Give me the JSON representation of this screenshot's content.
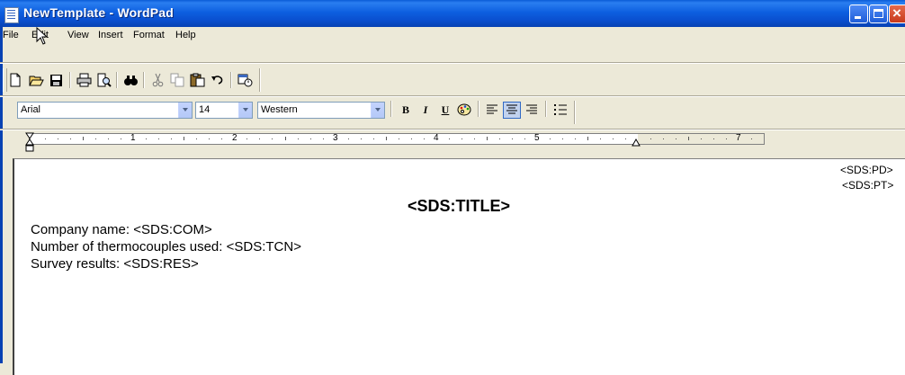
{
  "window": {
    "title": "NewTemplate - WordPad",
    "controls": [
      "minimize",
      "maximize",
      "close"
    ]
  },
  "menu": {
    "items": [
      "File",
      "Edit",
      "View",
      "Insert",
      "Format",
      "Help"
    ]
  },
  "toolbar": {
    "buttons": [
      "new-icon",
      "open-icon",
      "save-icon",
      "print-icon",
      "print-preview-icon",
      "find-icon",
      "cut-icon",
      "copy-icon",
      "paste-icon",
      "undo-icon",
      "date-time-icon"
    ]
  },
  "format_bar": {
    "font": "Arial",
    "size": "14",
    "script": "Western",
    "bold_label": "B",
    "italic_label": "I",
    "underline_label": "U",
    "buttons": [
      "bold-button",
      "italic-button",
      "underline-button",
      "color-button",
      "align-left-button",
      "align-center-button",
      "align-right-button",
      "bullets-button"
    ]
  },
  "ruler": {
    "numbers": [
      "1",
      "2",
      "3",
      "4",
      "5",
      "7"
    ]
  },
  "document": {
    "right_lines": [
      "<SDS:PD>",
      "<SDS:PT>"
    ],
    "title": "<SDS:TITLE>",
    "lines": [
      "Company name: <SDS:COM>",
      "Number of thermocouples used: <SDS:TCN>",
      "Survey results: <SDS:RES>"
    ]
  }
}
